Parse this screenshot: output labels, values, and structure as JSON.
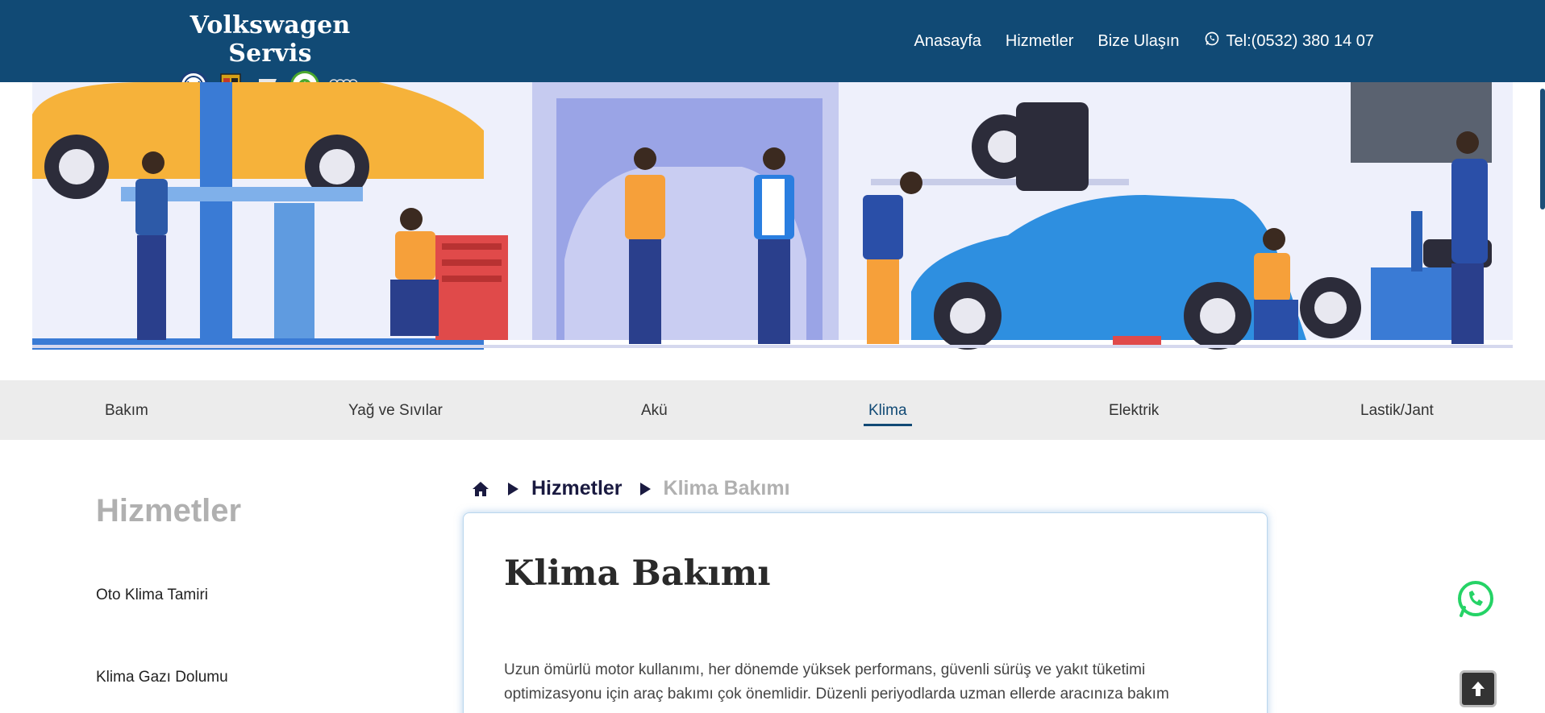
{
  "header": {
    "brand_title": "Volkswagen Servis",
    "brand_logos": [
      "vw-logo",
      "porsche-logo",
      "seat-logo",
      "skoda-logo",
      "audi-logo"
    ],
    "nav": [
      {
        "label": "Anasayfa"
      },
      {
        "label": "Hizmetler"
      },
      {
        "label": "Bize Ulaşın"
      },
      {
        "label": "Tel:(0532) 380 14 07",
        "icon": "whatsapp-icon"
      }
    ],
    "bg_color": "#114a75"
  },
  "service_tabs": {
    "items": [
      "Bakım",
      "Yağ ve Sıvılar",
      "Akü",
      "Klima",
      "Elektrik",
      "Lastik/Jant"
    ],
    "active": "Klima"
  },
  "sidebar": {
    "title": "Hizmetler",
    "items": [
      "Oto Klima Tamiri",
      "Klima Gazı Dolumu"
    ]
  },
  "breadcrumb": {
    "home_icon": "home-icon",
    "parent": "Hizmetler",
    "current": "Klima Bakımı"
  },
  "article": {
    "title": "Klima Bakımı",
    "body": "Uzun ömürlü motor kullanımı, her dönemde yüksek performans, güvenli sürüş ve yakıt tüketimi optimizasyonu için araç bakımı çok önemlidir. Düzenli periyodlarda uzman ellerde aracınıza bakım"
  },
  "floating": {
    "whatsapp_icon": "whatsapp-icon",
    "scroll_top_icon": "arrow-up-icon"
  },
  "colors": {
    "primary": "#114a75",
    "tab_bg": "#ececec",
    "whatsapp": "#25d366"
  }
}
